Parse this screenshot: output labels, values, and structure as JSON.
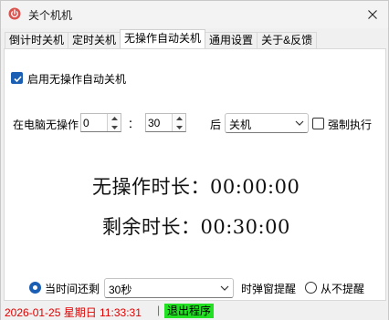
{
  "window": {
    "title": "关个机机"
  },
  "tabs": [
    {
      "label": "倒计时关机"
    },
    {
      "label": "定时关机"
    },
    {
      "label": "无操作自动关机",
      "active": true
    },
    {
      "label": "通用设置"
    },
    {
      "label": "关于&反馈"
    }
  ],
  "panel": {
    "enable_label": "启用无操作自动关机",
    "enable_checked": true,
    "idle_prefix": "在电脑无操作",
    "hours_value": "0",
    "colon": "：",
    "minutes_value": "30",
    "after_label": "后",
    "action_value": "关机",
    "force_label": "强制执行",
    "force_checked": false,
    "idle_time": "无操作时长：00:00:00",
    "remain_time": "剩余时长：00:30:00",
    "reminder": {
      "option1_label": "当时间还剩",
      "option1_selected": true,
      "remaining_value": "30秒",
      "popup_label": "时弹窗提醒",
      "option2_label": "从不提醒",
      "option2_selected": false
    }
  },
  "status": {
    "datetime": "2026-01-25 星期日 11:33:31",
    "separator": "|",
    "exit_label": "退出程序"
  },
  "colors": {
    "accent": "#1a5fb4",
    "status_red": "#e00000",
    "exit_green": "#22e022"
  }
}
